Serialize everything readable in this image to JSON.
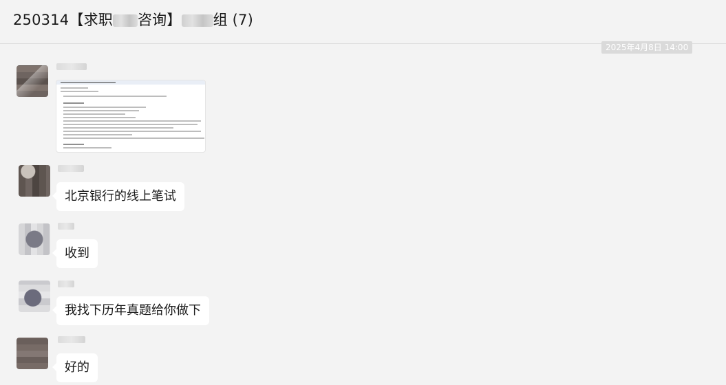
{
  "header": {
    "title_prefix": "250314【求职",
    "title_middle": "咨询】",
    "title_suffix": "组 (7)"
  },
  "chat": {
    "timestamp": "2025年4月8日 14:00",
    "messages": [
      {
        "type": "image",
        "sender": "member-1"
      },
      {
        "type": "text",
        "sender": "member-2",
        "text": "北京银行的线上笔试"
      },
      {
        "type": "text",
        "sender": "member-3",
        "text": "收到"
      },
      {
        "type": "text",
        "sender": "member-4",
        "text": "我找下历年真题给你做下"
      },
      {
        "type": "text",
        "sender": "member-5",
        "text": "好的"
      }
    ]
  }
}
